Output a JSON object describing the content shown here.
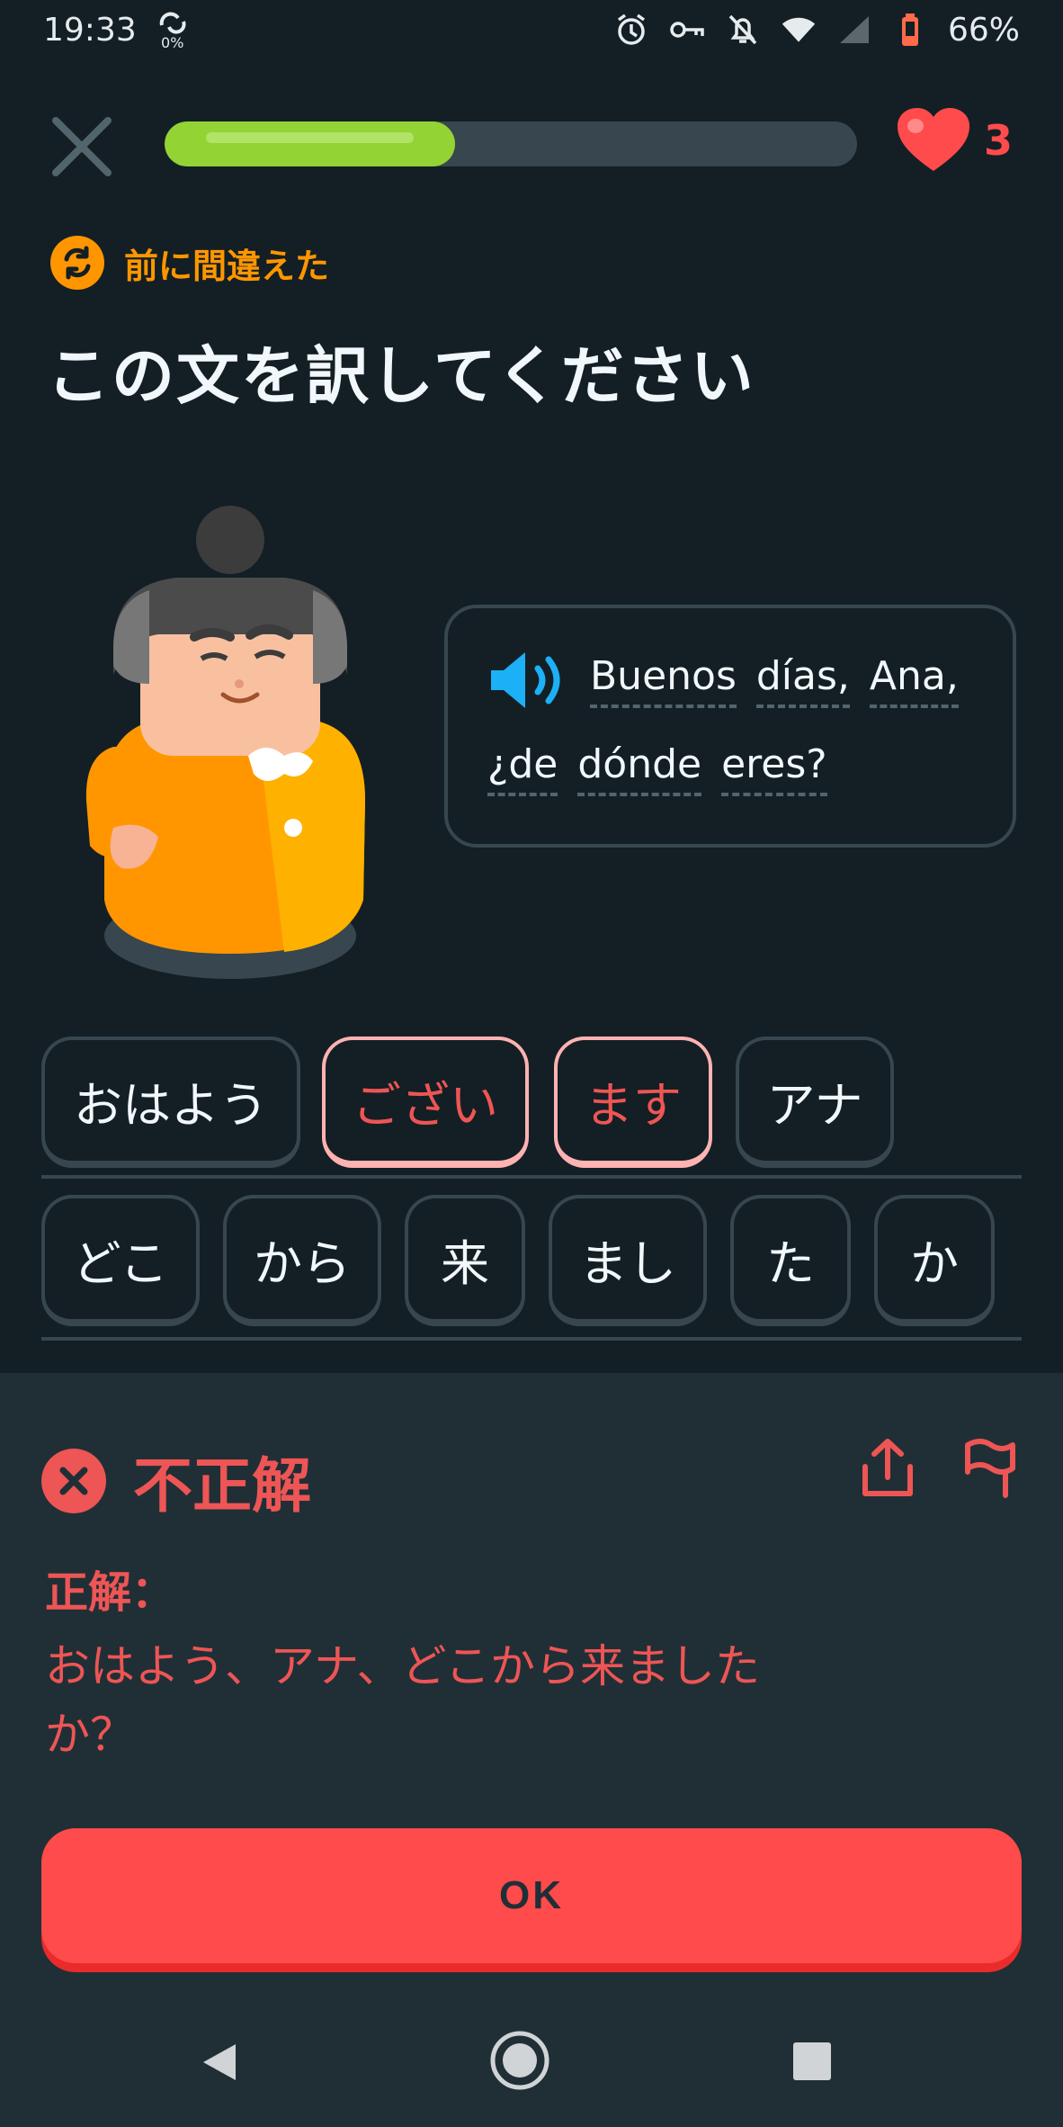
{
  "status_bar": {
    "time": "19:33",
    "data_usage": "0%",
    "battery_percent": "66%",
    "icons": [
      "data-saver-icon",
      "alarm-icon",
      "vpn-key-icon",
      "notifications-off-icon",
      "wifi-icon",
      "cell-signal-icon",
      "battery-icon"
    ]
  },
  "header": {
    "progress": 0.42,
    "hearts": "3"
  },
  "prompt": {
    "tag_label": "前に間違えた",
    "title": "この文を訳してください"
  },
  "bubble": {
    "line1": [
      "Buenos",
      "días,",
      "Ana,"
    ],
    "line2": [
      "¿de",
      "dónde",
      "eres?"
    ]
  },
  "answer_chips": [
    {
      "label": "おはよう",
      "state": "normal"
    },
    {
      "label": "ござい",
      "state": "wrong"
    },
    {
      "label": "ます",
      "state": "wrong"
    },
    {
      "label": "アナ",
      "state": "normal"
    }
  ],
  "bank_chips": [
    "どこ",
    "から",
    "来",
    "まし",
    "た",
    "か"
  ],
  "feedback": {
    "title": "不正解",
    "correct_label": "正解：",
    "correct_answer": "おはよう、アナ、どこから来ましたか？",
    "ok_label": "OK"
  },
  "colors": {
    "background": "#131f24",
    "panel": "#202f36",
    "progress": "#93d333",
    "error": "#ff4b4b",
    "warning": "#ff9600",
    "speaker": "#1cb0f6"
  }
}
